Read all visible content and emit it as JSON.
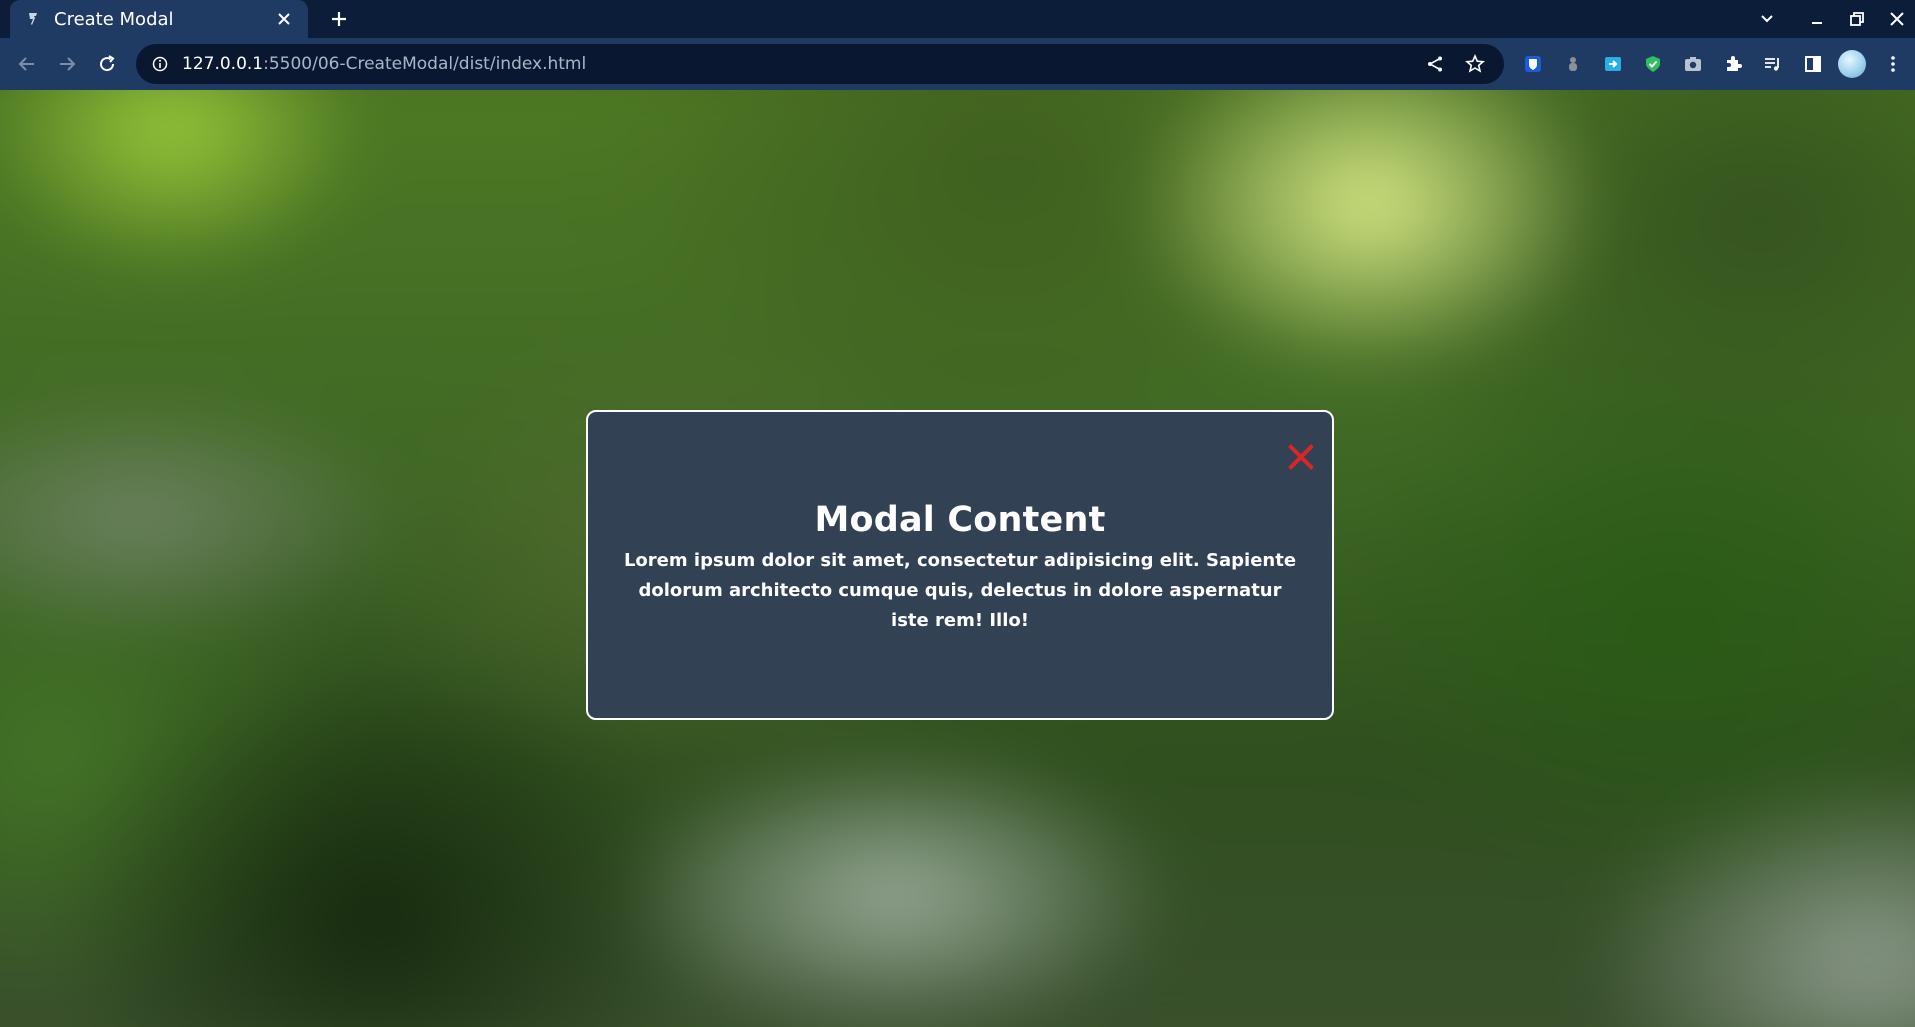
{
  "browser": {
    "tab": {
      "title": "Create Modal"
    },
    "address": {
      "host": "127.0.0.1",
      "path": ":5500/06-CreateModal/dist/index.html"
    },
    "icons": {
      "favicon": "favicon-icon",
      "tab_close": "close-icon",
      "new_tab": "plus-icon",
      "back": "arrow-left-icon",
      "forward": "arrow-right-icon",
      "reload": "reload-icon",
      "site_info": "info-icon",
      "share": "share-icon",
      "bookmark": "star-icon",
      "extensions": [
        "bitwarden-icon",
        "extension-icon",
        "translate-icon",
        "shield-icon",
        "camera-icon",
        "puzzle-icon",
        "media-icon",
        "side-panel-icon"
      ],
      "profile": "avatar",
      "menu": "kebab-menu-icon"
    }
  },
  "modal": {
    "title": "Modal Content",
    "body": "Lorem ipsum dolor sit amet, consectetur adipisicing elit. Sapiente dolorum architecto cumque quis, delectus in dolore aspernatur iste rem! Illo!",
    "close_icon": "close-icon"
  },
  "colors": {
    "chrome_dark": "#0c1d3a",
    "chrome_toolbar": "#1f3a63",
    "modal_background": "#334155",
    "modal_border": "#ffffff",
    "close_icon": "#dc2626"
  }
}
